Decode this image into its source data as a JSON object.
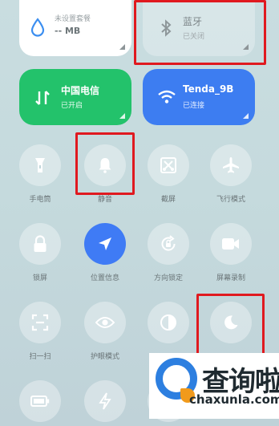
{
  "tiles": {
    "data_usage": {
      "title": "未设置套餐",
      "value": "-- MB"
    },
    "bluetooth": {
      "title": "蓝牙",
      "status": "已关闭"
    },
    "mobile_data": {
      "title": "中国电信",
      "status": "已开启"
    },
    "wifi": {
      "title": "Tenda_9B",
      "status": "已连接"
    }
  },
  "toggles": [
    {
      "label": "手电筒",
      "icon": "flashlight-icon",
      "active": false
    },
    {
      "label": "静音",
      "icon": "bell-icon",
      "active": false
    },
    {
      "label": "截屏",
      "icon": "screenshot-icon",
      "active": false
    },
    {
      "label": "飞行模式",
      "icon": "airplane-icon",
      "active": false
    },
    {
      "label": "锁屏",
      "icon": "lock-icon",
      "active": false
    },
    {
      "label": "位置信息",
      "icon": "location-icon",
      "active": true
    },
    {
      "label": "方向锁定",
      "icon": "rotation-lock-icon",
      "active": false
    },
    {
      "label": "屏幕录制",
      "icon": "video-camera-icon",
      "active": false
    },
    {
      "label": "扫一扫",
      "icon": "scan-icon",
      "active": false
    },
    {
      "label": "护眼模式",
      "icon": "eye-icon",
      "active": false
    },
    {
      "label": "",
      "icon": "contrast-icon",
      "active": false
    },
    {
      "label": "",
      "icon": "moon-icon",
      "active": false
    }
  ],
  "watermark": {
    "title": "查询啦",
    "url": "chaxunla.com"
  },
  "colors": {
    "accent": "#3f7bf5",
    "mobile_tile": "#23c26b",
    "wifi_tile": "#3d7df1",
    "highlight": "#e0191f"
  }
}
